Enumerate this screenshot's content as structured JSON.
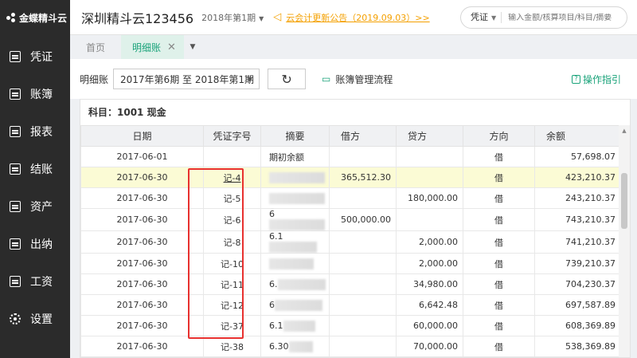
{
  "brand": {
    "name": "金蝶精斗云"
  },
  "header": {
    "company": "深圳精斗云123456",
    "period": "2018年第1期",
    "notice": "云会计更新公告（2019.09.03）>>"
  },
  "search": {
    "type": "凭证",
    "placeholder": "输入金额/核算项目/科目/摘要"
  },
  "sidebar": {
    "items": [
      {
        "label": "凭证",
        "icon": "voucher-icon"
      },
      {
        "label": "账簿",
        "icon": "ledger-icon"
      },
      {
        "label": "报表",
        "icon": "report-icon"
      },
      {
        "label": "结账",
        "icon": "close-account-icon"
      },
      {
        "label": "资产",
        "icon": "asset-icon"
      },
      {
        "label": "出纳",
        "icon": "cashier-icon"
      },
      {
        "label": "工资",
        "icon": "salary-icon"
      },
      {
        "label": "设置",
        "icon": "gear-icon"
      }
    ]
  },
  "tabs": [
    {
      "label": "首页"
    },
    {
      "label": "明细账"
    }
  ],
  "toolbar": {
    "label": "明细账",
    "range": "2017年第6期 至 2018年第1期",
    "flow_link": "账簿管理流程",
    "guide": "操作指引"
  },
  "subject": "科目：1001 现金",
  "table": {
    "columns": [
      "日期",
      "凭证字号",
      "摘要",
      "借方",
      "贷方",
      "方向",
      "余额"
    ],
    "rows": [
      {
        "date": "2017-06-01",
        "voucher": "",
        "summary": "期初余额",
        "debit": "",
        "credit": "",
        "dir": "借",
        "balance": "57,698.07"
      },
      {
        "date": "2017-06-30",
        "voucher": "记-4",
        "summary": "",
        "debit": "365,512.30",
        "credit": "",
        "dir": "借",
        "balance": "423,210.37"
      },
      {
        "date": "2017-06-30",
        "voucher": "记-5",
        "summary": "",
        "debit": "",
        "credit": "180,000.00",
        "dir": "借",
        "balance": "243,210.37"
      },
      {
        "date": "2017-06-30",
        "voucher": "记-6",
        "summary": "6",
        "debit": "500,000.00",
        "credit": "",
        "dir": "借",
        "balance": "743,210.37"
      },
      {
        "date": "2017-06-30",
        "voucher": "记-8",
        "summary": "6.1",
        "debit": "",
        "credit": "2,000.00",
        "dir": "借",
        "balance": "741,210.37"
      },
      {
        "date": "2017-06-30",
        "voucher": "记-10",
        "summary": "",
        "debit": "",
        "credit": "2,000.00",
        "dir": "借",
        "balance": "739,210.37"
      },
      {
        "date": "2017-06-30",
        "voucher": "记-11",
        "summary": "6.",
        "debit": "",
        "credit": "34,980.00",
        "dir": "借",
        "balance": "704,230.37"
      },
      {
        "date": "2017-06-30",
        "voucher": "记-12",
        "summary": "6",
        "debit": "",
        "credit": "6,642.48",
        "dir": "借",
        "balance": "697,587.89"
      },
      {
        "date": "2017-06-30",
        "voucher": "记-37",
        "summary": "6.1",
        "debit": "",
        "credit": "60,000.00",
        "dir": "借",
        "balance": "608,369.89"
      },
      {
        "date": "2017-06-30",
        "voucher": "记-38",
        "summary": "6.30",
        "debit": "",
        "credit": "70,000.00",
        "dir": "借",
        "balance": "538,369.89"
      }
    ]
  },
  "colors": {
    "accent": "#1aa37a",
    "notice": "#f4a000",
    "highlight_row": "#fbfbd5",
    "annotation": "#e8312f",
    "sidebar_bg": "#2b2b2b"
  }
}
